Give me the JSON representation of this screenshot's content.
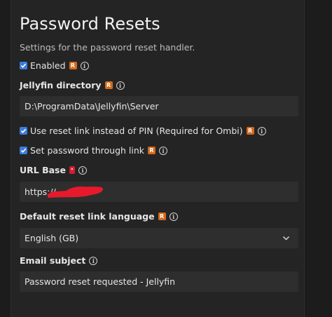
{
  "section": {
    "title": "Password Resets",
    "subtitle": "Settings for the password reset handler."
  },
  "enabled": {
    "label": "Enabled",
    "checked": true,
    "badge": "R",
    "info": "i"
  },
  "jellyfin_directory": {
    "label": "Jellyfin directory",
    "badge": "R",
    "info": "i",
    "value": "D:\\ProgramData\\Jellyfin\\Server"
  },
  "use_reset_link": {
    "label": "Use reset link instead of PIN (Required for Ombi)",
    "checked": true,
    "badge": "R",
    "info": "i"
  },
  "set_password_link": {
    "label": "Set password through link",
    "checked": true,
    "badge": "R",
    "info": "i"
  },
  "url_base": {
    "label": "URL Base",
    "badge": "*",
    "info": "i",
    "value": "https://"
  },
  "default_language": {
    "label": "Default reset link language",
    "badge": "R",
    "info": "i",
    "selected": "English (GB)"
  },
  "email_subject": {
    "label": "Email subject",
    "info": "i",
    "value": "Password reset requested - Jellyfin"
  },
  "colors": {
    "background": "#1c1c1c",
    "panel": "#242424",
    "field": "#2e2e2e",
    "checkbox": "#3b7ddd",
    "badge": "#d4691c",
    "required_badge": "#d21d33",
    "redaction": "#e8192c"
  }
}
